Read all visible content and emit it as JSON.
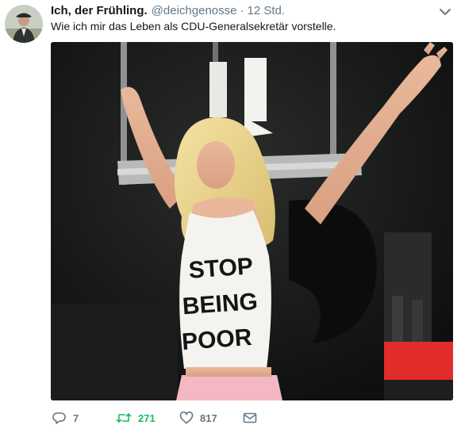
{
  "tweet": {
    "author_name": "Ich, der Frühling.",
    "handle": "@deichgenosse",
    "separator": "·",
    "timestamp": "12 Std.",
    "text": "Wie ich mir das Leben als CDU-Generalsekretär vorstelle.",
    "shirt_lines": [
      "STOP",
      "BEING",
      "POOR"
    ]
  },
  "actions": {
    "reply_count": "7",
    "retweet_count": "271",
    "like_count": "817"
  },
  "icons": {
    "reply": "reply-icon",
    "retweet": "retweet-icon",
    "like": "heart-icon",
    "message": "envelope-icon",
    "menu": "chevron-down-icon"
  },
  "colors": {
    "text": "#14171a",
    "muted": "#657786",
    "retweet_active": "#17bf63"
  }
}
